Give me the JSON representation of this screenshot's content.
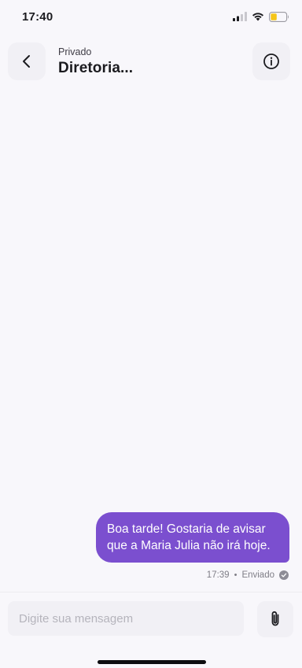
{
  "status_bar": {
    "time": "17:40",
    "icons": [
      "cellular-signal-icon",
      "wifi-icon",
      "battery-icon"
    ],
    "battery_color": "#f5c518"
  },
  "header": {
    "subtitle": "Privado",
    "title": "Diretoria...",
    "back_icon": "chevron-left-icon",
    "info_icon": "info-circle-icon"
  },
  "messages": [
    {
      "text": "Boa tarde! Gostaria de avisar que a Maria Julia não irá hoje.",
      "time": "17:39",
      "separator": "•",
      "status": "Enviado",
      "status_icon": "check-circle-icon",
      "bubble_color": "#7b4fcf"
    }
  ],
  "composer": {
    "placeholder": "Digite sua mensagem",
    "value": "",
    "attach_icon": "paperclip-icon"
  }
}
